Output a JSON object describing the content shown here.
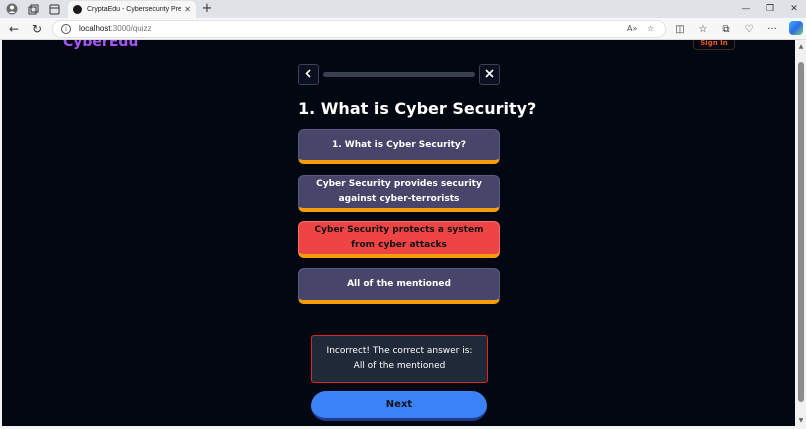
{
  "browser": {
    "tab_title": "CryptaEdu - Cybersecurity Preven",
    "url_host": "localhost",
    "url_path": ":3000/quizz"
  },
  "page": {
    "brand": "CyberEdu",
    "signin_label": "Sign In",
    "progress_fraction": 0.0,
    "question": "1. What is Cyber Security?",
    "options": [
      {
        "label": "1. What is Cyber Security?",
        "state": "default"
      },
      {
        "label": "Cyber Security provides security against cyber-terrorists",
        "state": "default"
      },
      {
        "label": "Cyber Security protects a system from cyber attacks",
        "state": "incorrect"
      },
      {
        "label": "All of the mentioned",
        "state": "default"
      }
    ],
    "feedback": "Incorrect! The correct answer is: All of the mentioned",
    "next_label": "Next"
  },
  "icons": {
    "back": "chevron-left-icon",
    "close": "close-icon"
  },
  "colors": {
    "page_bg": "#030712",
    "brand": "#a855f7",
    "option_bg": "#474569",
    "option_accent": "#f59e0b",
    "incorrect": "#ef4444",
    "next_button": "#3b82f6"
  }
}
